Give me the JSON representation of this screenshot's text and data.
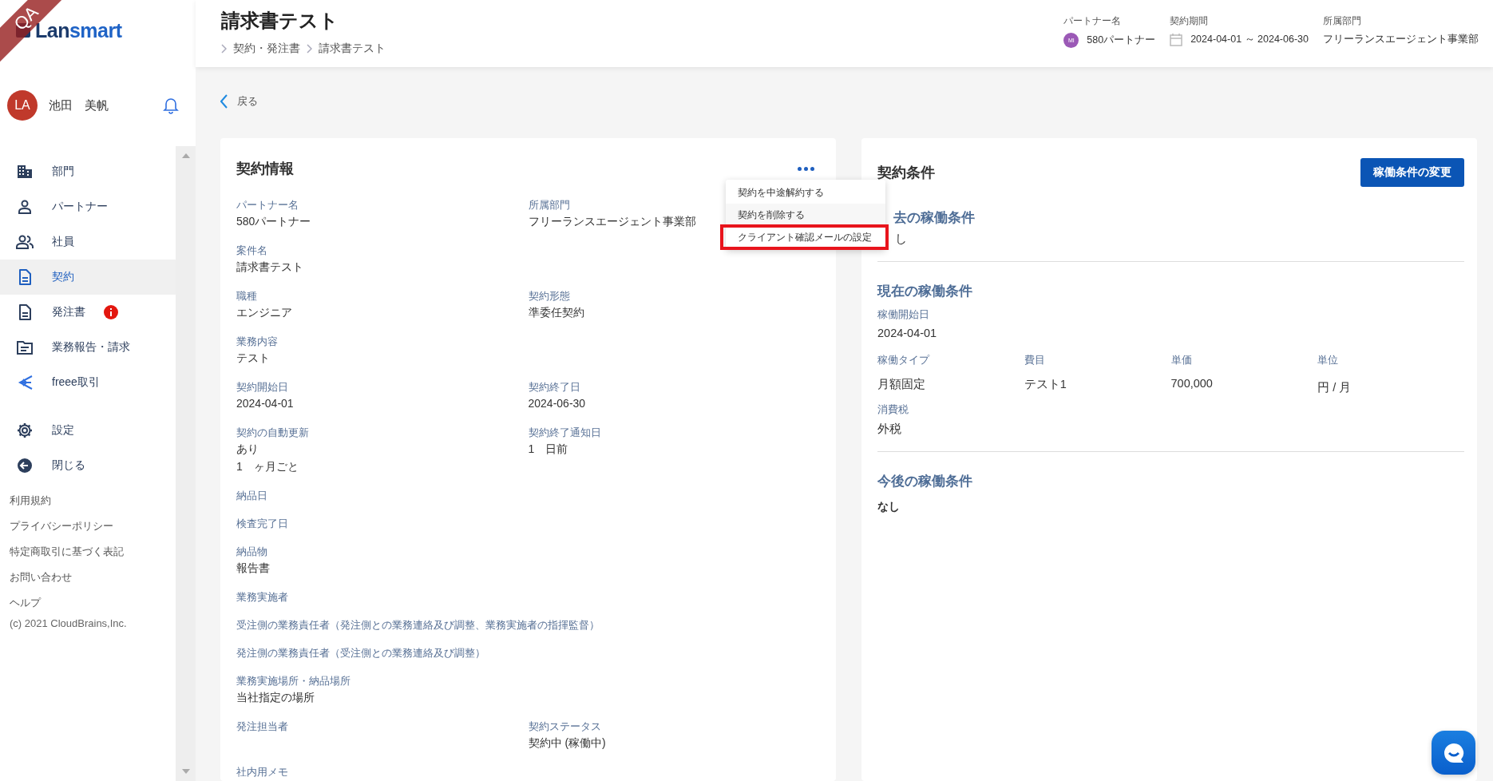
{
  "env_ribbon": "QA",
  "logo": {
    "first": "Lan",
    "second": "smart"
  },
  "user": {
    "initials": "LA",
    "name": "池田　美帆"
  },
  "nav": [
    {
      "label": "部門",
      "kind": "building",
      "selected": false,
      "alert": false
    },
    {
      "label": "パートナー",
      "kind": "person",
      "selected": false,
      "alert": false
    },
    {
      "label": "社員",
      "kind": "people",
      "selected": false,
      "alert": false
    },
    {
      "label": "契約",
      "kind": "document",
      "selected": true,
      "alert": false
    },
    {
      "label": "発注書",
      "kind": "document",
      "selected": false,
      "alert": true
    },
    {
      "label": "業務報告・請求",
      "kind": "folder",
      "selected": false,
      "alert": false
    },
    {
      "label": "freee取引",
      "kind": "freee",
      "selected": false,
      "alert": false
    }
  ],
  "nav_secondary": [
    {
      "label": "設定",
      "kind": "settings"
    },
    {
      "label": "閉じる",
      "kind": "collapse"
    }
  ],
  "footer_links": [
    "利用規約",
    "プライバシーポリシー",
    "特定商取引に基づく表記",
    "お問い合わせ",
    "ヘルプ"
  ],
  "copyright": "(c) 2021 CloudBrains,Inc.",
  "header": {
    "title": "請求書テスト",
    "breadcrumb": [
      "契約・発注書",
      "請求書テスト"
    ],
    "meta": [
      {
        "label": "パートナー名",
        "kind": "avatar",
        "avatar": "MI",
        "value": "580パートナー"
      },
      {
        "label": "契約期間",
        "kind": "calendar",
        "value": "2024-04-01 ～ 2024-06-30"
      },
      {
        "label": "所属部門",
        "kind": "plain",
        "value": "フリーランスエージェント事業部"
      }
    ]
  },
  "back": "戻る",
  "contract_info": {
    "title": "契約情報",
    "menu": [
      {
        "label": "契約を中途解約する",
        "highlighted": false
      },
      {
        "label": "契約を削除する",
        "highlighted": false
      },
      {
        "label": "クライアント確認メールの設定",
        "highlighted": true
      }
    ],
    "rows": [
      [
        {
          "label": "パートナー名",
          "values": [
            "580パートナー"
          ]
        },
        {
          "label": "所属部門",
          "values": [
            "フリーランスエージェント事業部"
          ]
        }
      ],
      [
        {
          "label": "案件名",
          "values": [
            "請求書テスト"
          ]
        }
      ],
      [
        {
          "label": "職種",
          "values": [
            "エンジニア"
          ]
        },
        {
          "label": "契約形態",
          "values": [
            "準委任契約"
          ]
        }
      ],
      [
        {
          "label": "業務内容",
          "values": [
            "テスト"
          ]
        }
      ],
      [
        {
          "label": "契約開始日",
          "values": [
            "2024-04-01"
          ]
        },
        {
          "label": "契約終了日",
          "values": [
            "2024-06-30"
          ]
        }
      ],
      [
        {
          "label": "契約の自動更新",
          "values": [
            "あり",
            "1　ヶ月ごと"
          ]
        },
        {
          "label": "契約終了通知日",
          "values": [
            "1　日前"
          ]
        }
      ],
      [
        {
          "label": "納品日"
        }
      ],
      [
        {
          "label": "検査完了日"
        }
      ],
      [
        {
          "label": "納品物",
          "values": [
            "報告書"
          ]
        }
      ],
      [
        {
          "label": "業務実施者"
        }
      ],
      [
        {
          "label": "受注側の業務責任者（発注側との業務連絡及び調整、業務実施者の指揮監督）"
        }
      ],
      [
        {
          "label": "発注側の業務責任者（受注側との業務連絡及び調整）"
        }
      ],
      [
        {
          "label": "業務実施場所・納品場所",
          "values": [
            "当社指定の場所"
          ]
        }
      ],
      [
        {
          "label": "発注担当者"
        },
        {
          "label": "契約ステータス",
          "values": [
            "契約中 (稼働中)"
          ]
        }
      ],
      [
        {
          "label": "社内用メモ"
        }
      ]
    ]
  },
  "terms": {
    "title": "契約条件",
    "button": "稼働条件の変更",
    "past": {
      "heading": "去の稼働条件",
      "value": "し"
    },
    "current": {
      "heading": "現在の稼働条件",
      "start_label": "稼働開始日",
      "start_value": "2024-04-01",
      "columns": [
        {
          "label": "稼働タイプ",
          "value": "月額固定"
        },
        {
          "label": "費目",
          "value": "テスト1"
        },
        {
          "label": "単価",
          "value": "700,000"
        },
        {
          "label": "単位",
          "value": "円 / 月"
        }
      ],
      "tax_label": "消費税",
      "tax_value": "外税"
    },
    "future": {
      "heading": "今後の稼働条件",
      "value": "なし"
    }
  }
}
